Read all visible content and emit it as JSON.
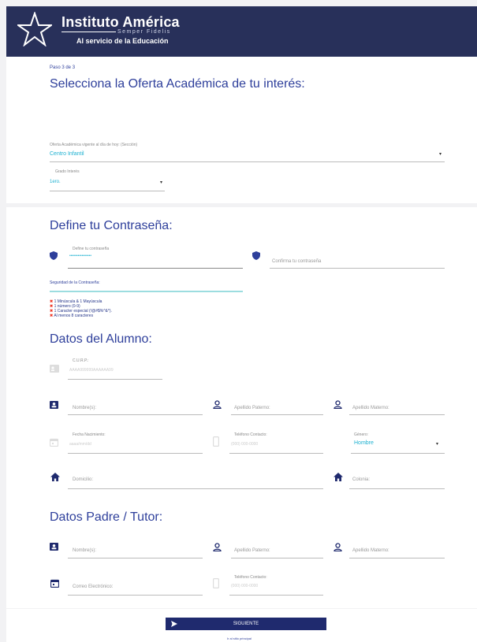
{
  "header": {
    "brand_title": "Instituto América",
    "motto": "Semper Fidelis",
    "tagline": "Al servicio de la Educación"
  },
  "step": "Paso 3 de 3",
  "offer": {
    "title": "Selecciona la Oferta Académica de tu interés:",
    "section_label": "Oferta Académica vigente al día de hoy: (Sección)",
    "section_value": "Centro Infantil",
    "grade_label": "Grado Interés",
    "grade_value": "1ero."
  },
  "password": {
    "title": "Define tu Contraseña:",
    "define_label": "Define tu contraseña",
    "define_value": "••••••••••••••••",
    "confirm_placeholder": "Confirma tu contraseña",
    "strength_label": "Seguridad de la Contraseña:",
    "requirements": [
      "1 Minúscula & 1 Mayúscula",
      "1 número (0-9)",
      "1 Caracter especial (!@#$%^&*).",
      "Al menos 8 caracteres"
    ]
  },
  "student": {
    "title": "Datos del Alumno:",
    "curp_label": "C.U.R.P.:",
    "curp_placeholder": "AAAA999999AAAAAA99",
    "nombre": "Nombre(s):",
    "apellido_paterno": "Apellido Paterno:",
    "apellido_materno": "Apellido Materno:",
    "birth_label": "Fecha Nacimiento:",
    "birth_placeholder": "aaaa/mm/dd",
    "phone_label": "Teléfono Contacto:",
    "phone_placeholder": "(000) 000-0000",
    "gender_label": "Género:",
    "gender_value": "Hombre",
    "domicilio": "Domicilio:",
    "colonia": "Colonia:"
  },
  "tutor": {
    "title": "Datos Padre / Tutor:",
    "nombre": "Nombre(s):",
    "apellido_paterno": "Apellido Paterno:",
    "apellido_materno": "Apellido Materno:",
    "email": "Correo Electrónico:",
    "phone_label": "Teléfono Contacto:",
    "phone_placeholder": "(000) 000-0000"
  },
  "actions": {
    "submit": "SIGUIENTE",
    "back": "Ir al sitio principal"
  },
  "colors": {
    "header": "#28305a",
    "title": "#2e3f9b",
    "accent": "#1bb0d0",
    "button": "#1f2a6e"
  }
}
